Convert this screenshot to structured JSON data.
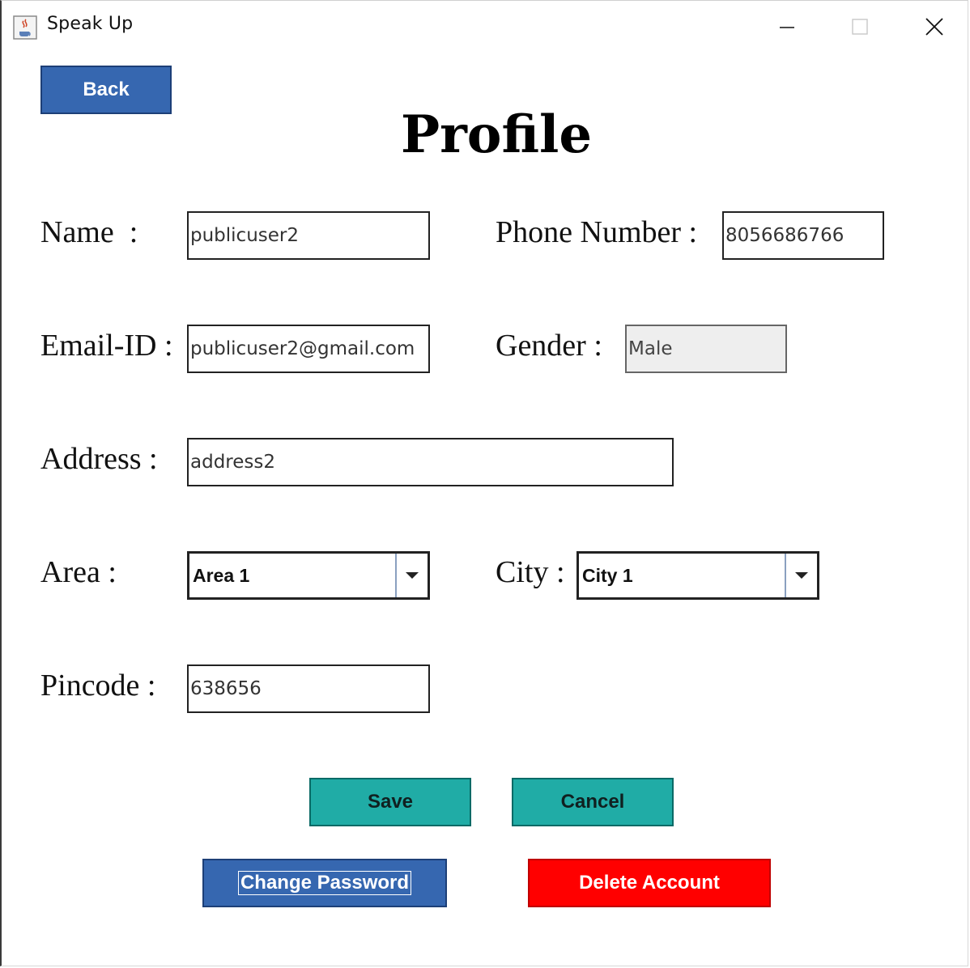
{
  "window": {
    "title": "Speak Up",
    "icon": "java-cup-icon",
    "controls": {
      "minimize": "minimize-icon",
      "maximize": "maximize-icon",
      "close": "close-icon"
    }
  },
  "nav": {
    "back_label": "Back"
  },
  "page": {
    "title": "Profile"
  },
  "form": {
    "name": {
      "label": "Name  :",
      "value": "publicuser2"
    },
    "phone": {
      "label": "Phone Number :",
      "value": "8056686766"
    },
    "email": {
      "label": "Email-ID :",
      "value": "publicuser2@gmail.com"
    },
    "gender": {
      "label": "Gender :",
      "value": "Male"
    },
    "address": {
      "label": "Address :",
      "value": "address2"
    },
    "area": {
      "label": "Area :",
      "selected": "Area 1"
    },
    "city": {
      "label": "City :",
      "selected": "City 1"
    },
    "pincode": {
      "label": "Pincode :",
      "value": "638656"
    }
  },
  "actions": {
    "save_label": "Save",
    "cancel_label": "Cancel",
    "change_password_label": "Change Password",
    "delete_account_label": "Delete Account"
  },
  "colors": {
    "primary_blue": "#3667b0",
    "teal": "#20aca6",
    "danger_red": "#ff0000"
  }
}
